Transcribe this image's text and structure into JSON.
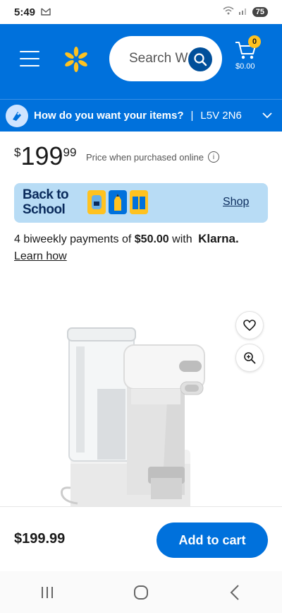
{
  "status_bar": {
    "time": "5:49",
    "mail_icon": "gmail-icon",
    "battery": "75"
  },
  "header": {
    "search_placeholder": "Search W",
    "cart_count": "0",
    "cart_total": "$0.00",
    "brand_color": "#0071dc",
    "spark_color": "#ffc220"
  },
  "delivery": {
    "question": "How do you want your items?",
    "separator": "|",
    "postal_code": "L5V 2N6"
  },
  "price": {
    "dollar_sign": "$",
    "whole": "199",
    "cents": "99",
    "note": "Price when purchased online",
    "info_symbol": "i"
  },
  "banner": {
    "title": "Back to School",
    "shop_label": "Shop"
  },
  "klarna": {
    "prefix": "4 biweekly payments of",
    "amount": "$50.00",
    "with": "with",
    "brand": "Klarna.",
    "learn_how": "Learn how"
  },
  "product": {
    "favorite_icon": "heart-icon",
    "zoom_icon": "zoom-in-icon"
  },
  "purchase": {
    "price": "$199.99",
    "add_to_cart": "Add to cart"
  }
}
